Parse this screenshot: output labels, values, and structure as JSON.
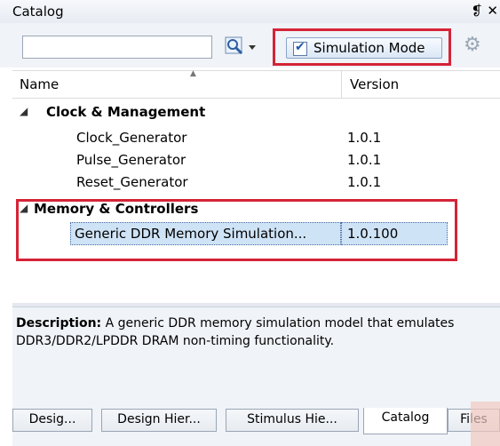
{
  "window": {
    "title": "Catalog",
    "controls": "❡ ✕"
  },
  "toolbar": {
    "search_value": "",
    "search_placeholder": "",
    "sim_mode_label": "Simulation Mode",
    "sim_mode_checked": true
  },
  "table": {
    "columns": [
      "Name",
      "Version"
    ],
    "groups": [
      {
        "name": "Clock & Management",
        "items": [
          {
            "name": "Clock_Generator",
            "version": "1.0.1"
          },
          {
            "name": "Pulse_Generator",
            "version": "1.0.1"
          },
          {
            "name": "Reset_Generator",
            "version": "1.0.1"
          }
        ]
      },
      {
        "name": "Memory & Controllers",
        "items": [
          {
            "name": "Generic DDR Memory Simulation...",
            "version": "1.0.100"
          }
        ]
      }
    ]
  },
  "description": {
    "label": "Description:",
    "text": "A generic DDR memory simulation model that emulates DDR3/DDR2/LPDDR DRAM non-timing functionality."
  },
  "tabs": [
    "Desig...",
    "Design Hier...",
    "Stimulus Hie...",
    "Catalog",
    "Files"
  ],
  "active_tab": "Catalog",
  "icons": {
    "search": "search-icon",
    "gear": "gear-icon",
    "collapse": "collapse-triangle-icon"
  },
  "colors": {
    "highlight": "#d52437",
    "selection": "#cfe3f6"
  }
}
